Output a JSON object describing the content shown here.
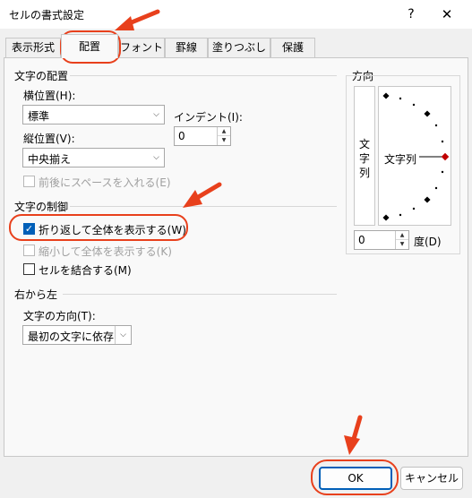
{
  "window": {
    "title": "セルの書式設定",
    "help": "?",
    "close": "✕"
  },
  "tabs": [
    "表示形式",
    "配置",
    "フォント",
    "罫線",
    "塗りつぶし",
    "保護"
  ],
  "alignment": {
    "section": "文字の配置",
    "horizontal_label": "横位置(H):",
    "horizontal_value": "標準",
    "indent_label": "インデント(I):",
    "indent_value": "0",
    "vertical_label": "縦位置(V):",
    "vertical_value": "中央揃え",
    "distributed_label": "前後にスペースを入れる(E)"
  },
  "control": {
    "section": "文字の制御",
    "wrap_label": "折り返して全体を表示する(W)",
    "wrap_checked": true,
    "shrink_label": "縮小して全体を表示する(K)",
    "merge_label": "セルを結合する(M)"
  },
  "rtl": {
    "section": "右から左",
    "direction_label": "文字の方向(T):",
    "direction_value": "最初の文字に依存"
  },
  "orientation": {
    "section": "方向",
    "vertical_text": [
      "文",
      "字",
      "列"
    ],
    "dial_text": "文字列",
    "degrees_value": "0",
    "degrees_label": "度(D)"
  },
  "buttons": {
    "ok": "OK",
    "cancel": "キャンセル"
  },
  "colors": {
    "accent": "#005fb8",
    "annotation": "#e8401c",
    "dial_marker": "#c00000"
  }
}
